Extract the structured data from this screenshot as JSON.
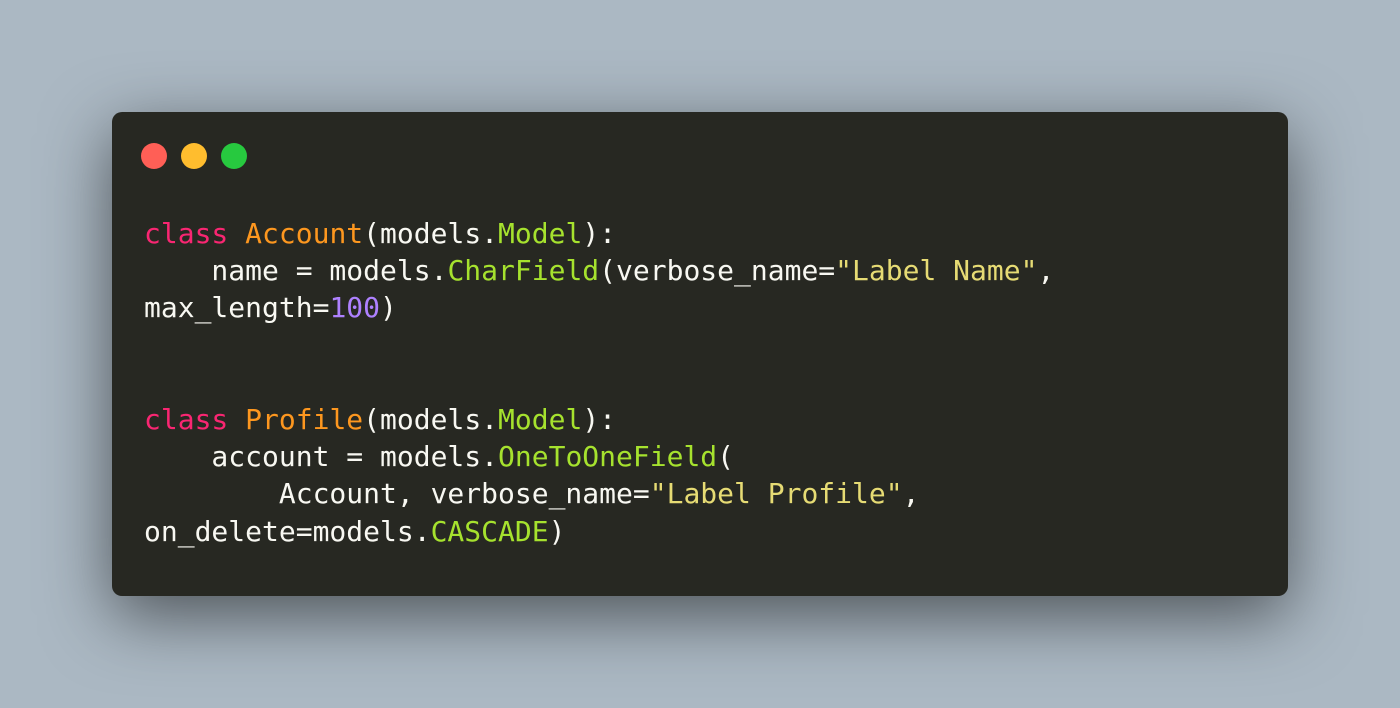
{
  "window": {
    "controls": [
      {
        "name": "close-button",
        "color": "#ff5f56"
      },
      {
        "name": "minimize-button",
        "color": "#ffbd2e"
      },
      {
        "name": "maximize-button",
        "color": "#27c93f"
      }
    ]
  },
  "code": {
    "language": "python",
    "lines": [
      [
        {
          "text": "class",
          "kind": "keyword"
        },
        {
          "text": " ",
          "kind": "plain"
        },
        {
          "text": "Account",
          "kind": "class"
        },
        {
          "text": "(models.",
          "kind": "plain"
        },
        {
          "text": "Model",
          "kind": "type"
        },
        {
          "text": "):",
          "kind": "plain"
        }
      ],
      [
        {
          "text": "    name = models.",
          "kind": "plain"
        },
        {
          "text": "CharField",
          "kind": "type"
        },
        {
          "text": "(verbose_name=",
          "kind": "plain"
        },
        {
          "text": "\"Label Name\"",
          "kind": "string"
        },
        {
          "text": ",",
          "kind": "plain"
        }
      ],
      [
        {
          "text": "max_length=",
          "kind": "plain"
        },
        {
          "text": "100",
          "kind": "number"
        },
        {
          "text": ")",
          "kind": "plain"
        }
      ],
      [],
      [],
      [
        {
          "text": "class",
          "kind": "keyword"
        },
        {
          "text": " ",
          "kind": "plain"
        },
        {
          "text": "Profile",
          "kind": "class"
        },
        {
          "text": "(models.",
          "kind": "plain"
        },
        {
          "text": "Model",
          "kind": "type"
        },
        {
          "text": "):",
          "kind": "plain"
        }
      ],
      [
        {
          "text": "    account = models.",
          "kind": "plain"
        },
        {
          "text": "OneToOneField",
          "kind": "type"
        },
        {
          "text": "(",
          "kind": "plain"
        }
      ],
      [
        {
          "text": "        Account, verbose_name=",
          "kind": "plain"
        },
        {
          "text": "\"Label Profile\"",
          "kind": "string"
        },
        {
          "text": ",",
          "kind": "plain"
        }
      ],
      [
        {
          "text": "on_delete=models.",
          "kind": "plain"
        },
        {
          "text": "CASCADE",
          "kind": "type"
        },
        {
          "text": ")",
          "kind": "plain"
        }
      ]
    ]
  }
}
